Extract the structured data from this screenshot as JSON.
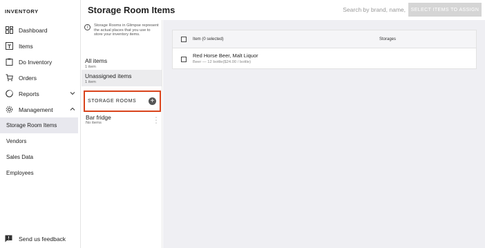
{
  "nav": {
    "header": "INVENTORY",
    "items": [
      {
        "label": "Dashboard",
        "icon": "dashboard-icon"
      },
      {
        "label": "Items",
        "icon": "items-icon"
      },
      {
        "label": "Do Inventory",
        "icon": "clipboard-icon"
      },
      {
        "label": "Orders",
        "icon": "cart-icon"
      },
      {
        "label": "Reports",
        "icon": "reports-icon"
      },
      {
        "label": "Management",
        "icon": "gear-icon"
      }
    ],
    "subitems": [
      {
        "label": "Storage Room Items"
      },
      {
        "label": "Vendors"
      },
      {
        "label": "Sales Data"
      },
      {
        "label": "Employees"
      }
    ],
    "footer": "Send us feedback"
  },
  "header": {
    "title": "Storage Room Items",
    "search_placeholder": "Search by brand, name,",
    "assign_label": "SELECT ITEMS TO ASSIGN"
  },
  "rooms": {
    "info": "Storage Rooms in Glimpse represent the actual places that you use to store your inventory items.",
    "all": {
      "name": "All items",
      "count": "1 item"
    },
    "unassigned": {
      "name": "Unassigned items",
      "count": "1 item"
    },
    "section_label": "STORAGE ROOMS",
    "list": [
      {
        "name": "Bar fridge",
        "count": "No items"
      }
    ]
  },
  "table": {
    "col_item": "Item (0 selected)",
    "col_storages": "Storages",
    "rows": [
      {
        "name": "Red Horse Beer, Malt Liquor",
        "detail": "Beer — 12 bottle($24.00 / bottle)"
      }
    ]
  },
  "colors": {
    "highlight": "#d9431b",
    "main_bg": "#efeff3",
    "button_disabled": "#d5d5d5"
  }
}
